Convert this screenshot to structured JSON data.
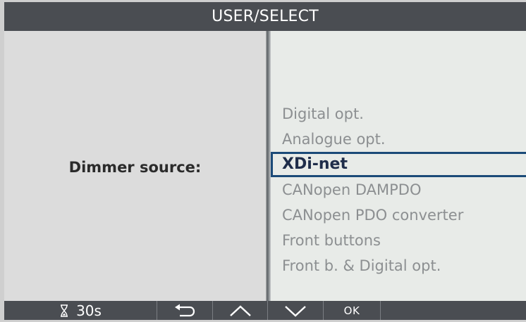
{
  "title": "USER/SELECT",
  "field_label": "Dimmer source:",
  "options": [
    {
      "label": "Digital opt.",
      "selected": false
    },
    {
      "label": "Analogue opt.",
      "selected": false
    },
    {
      "label": "XDi-net",
      "selected": true
    },
    {
      "label": "CANopen DAMPDO",
      "selected": false
    },
    {
      "label": "CANopen PDO converter",
      "selected": false
    },
    {
      "label": "Front buttons",
      "selected": false
    },
    {
      "label": "Front b. & Digital opt.",
      "selected": false
    }
  ],
  "softkeys": {
    "timer": {
      "icon": "hourglass-icon",
      "label": "30s"
    },
    "back": {
      "icon": "back-arrow-icon"
    },
    "up": {
      "icon": "chevron-up-icon"
    },
    "down": {
      "icon": "chevron-down-icon"
    },
    "ok": {
      "label": "OK"
    }
  },
  "colors": {
    "bar": "#4a4d52",
    "selection_border": "#1b4a78",
    "option_text": "#8c8f91",
    "selected_text": "#1f2d4a"
  }
}
